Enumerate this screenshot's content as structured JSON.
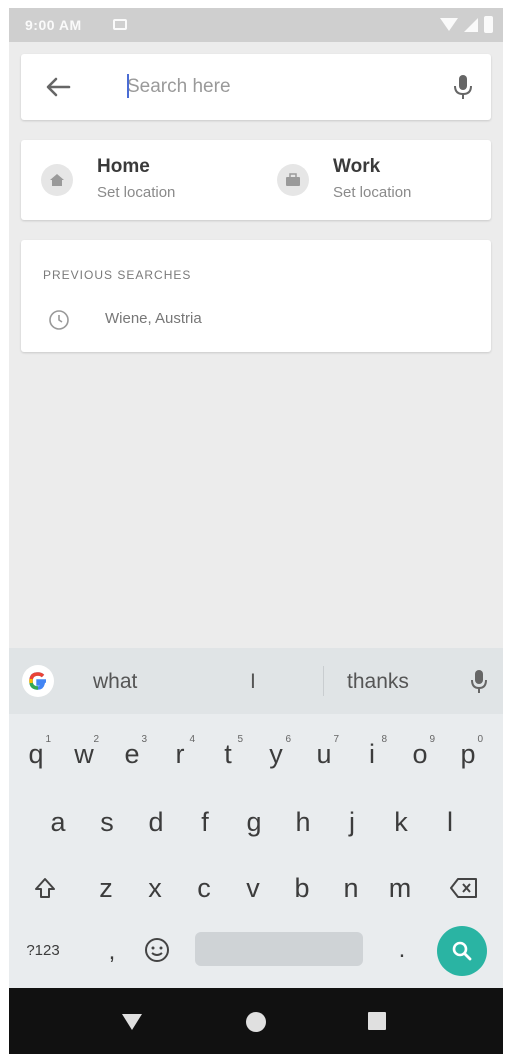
{
  "status_bar": {
    "time": "9:00 AM"
  },
  "search": {
    "placeholder": "Search here"
  },
  "places": {
    "home": {
      "title": "Home",
      "subtitle": "Set location"
    },
    "work": {
      "title": "Work",
      "subtitle": "Set location"
    }
  },
  "previous_searches": {
    "heading": "PREVIOUS SEARCHES",
    "items": [
      {
        "label": "Wiene, Austria"
      }
    ]
  },
  "keyboard": {
    "suggestions": [
      "what",
      "I",
      "thanks"
    ],
    "row1": [
      {
        "key": "q",
        "hint": "1"
      },
      {
        "key": "w",
        "hint": "2"
      },
      {
        "key": "e",
        "hint": "3"
      },
      {
        "key": "r",
        "hint": "4"
      },
      {
        "key": "t",
        "hint": "5"
      },
      {
        "key": "y",
        "hint": "6"
      },
      {
        "key": "u",
        "hint": "7"
      },
      {
        "key": "i",
        "hint": "8"
      },
      {
        "key": "o",
        "hint": "9"
      },
      {
        "key": "p",
        "hint": "0"
      }
    ],
    "row2": [
      "a",
      "s",
      "d",
      "f",
      "g",
      "h",
      "j",
      "k",
      "l"
    ],
    "row3": [
      "z",
      "x",
      "c",
      "v",
      "b",
      "n",
      "m"
    ],
    "symbols_label": "?123",
    "comma_label": ",",
    "period_label": ".",
    "icons": {
      "shift": "shift-icon",
      "backspace": "backspace-icon",
      "emoji": "emoji-icon",
      "search": "search-icon"
    }
  },
  "colors": {
    "accent": "#2ab4a3",
    "caret": "#4a6cd4"
  }
}
